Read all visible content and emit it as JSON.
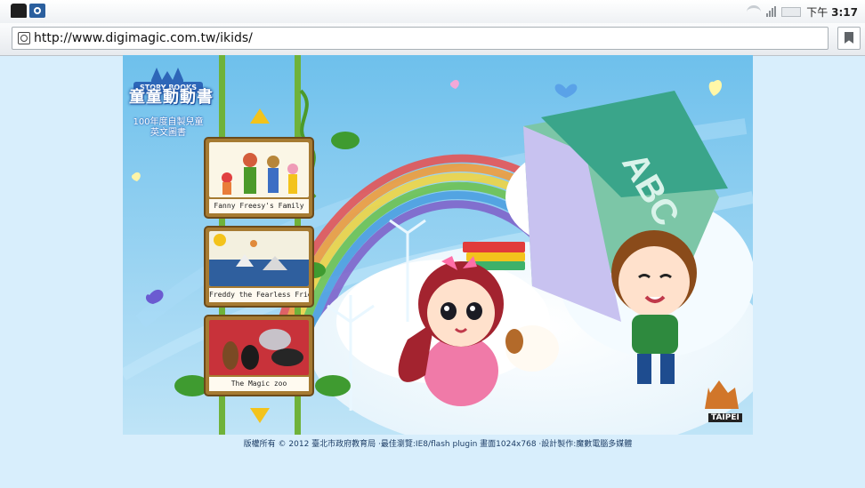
{
  "status_bar": {
    "time_prefix": "下午",
    "time": "3:17"
  },
  "address_bar": {
    "url": "http://www.digimagic.com.tw/ikids/"
  },
  "site": {
    "logo_banner": "STORY BOOKS",
    "logo_title": "童童動動書",
    "logo_subtitle": "100年度自製兒童英文圖書",
    "books": [
      {
        "title": "Fanny Freesy's Family"
      },
      {
        "title": "Freddy the Fearless Friend"
      },
      {
        "title": "The Magic zoo"
      }
    ],
    "taipei_label": "TAIPEI",
    "footer": "版權所有 © 2012 臺北市政府教育局 ·最佳瀏覽:IE8/flash plugin 畫面1024x768 ·設計製作:魔數電腦多媒體"
  },
  "colors": {
    "sky": "#7ec8ef",
    "accent_yellow": "#f3c31c",
    "vine_green": "#6fb23a",
    "card_frame": "#a67b32"
  }
}
